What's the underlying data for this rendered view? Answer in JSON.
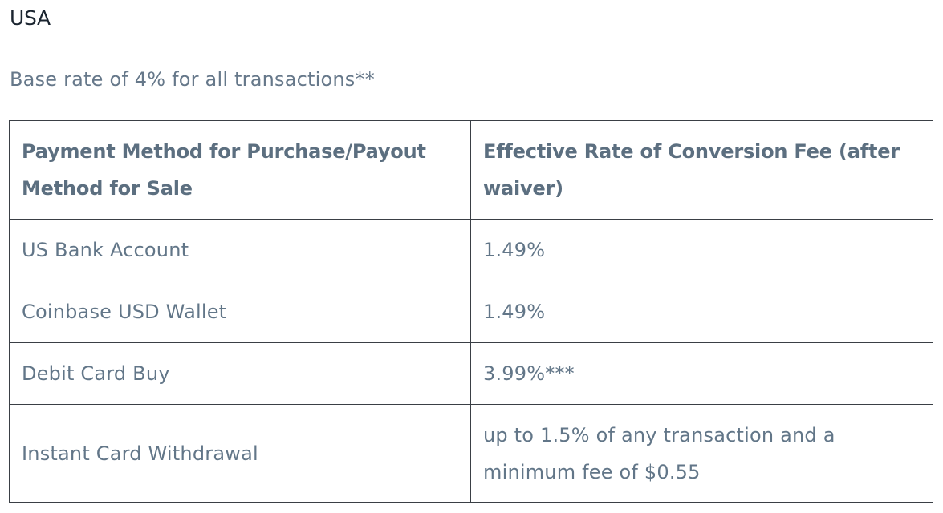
{
  "section": {
    "title": "USA",
    "subtitle": "Base rate of 4% for all transactions**"
  },
  "table": {
    "columns": [
      "Payment Method for Purchase/Payout Method for Sale",
      "Effective Rate of Conversion Fee (after waiver)"
    ],
    "rows": [
      {
        "method": "US Bank Account",
        "rate": "1.49%"
      },
      {
        "method": "Coinbase USD Wallet",
        "rate": "1.49%"
      },
      {
        "method": "Debit Card Buy",
        "rate": "3.99%***"
      },
      {
        "method": "Instant Card Withdrawal",
        "rate": "up to 1.5% of any transaction and a minimum fee of $0.55"
      }
    ]
  }
}
